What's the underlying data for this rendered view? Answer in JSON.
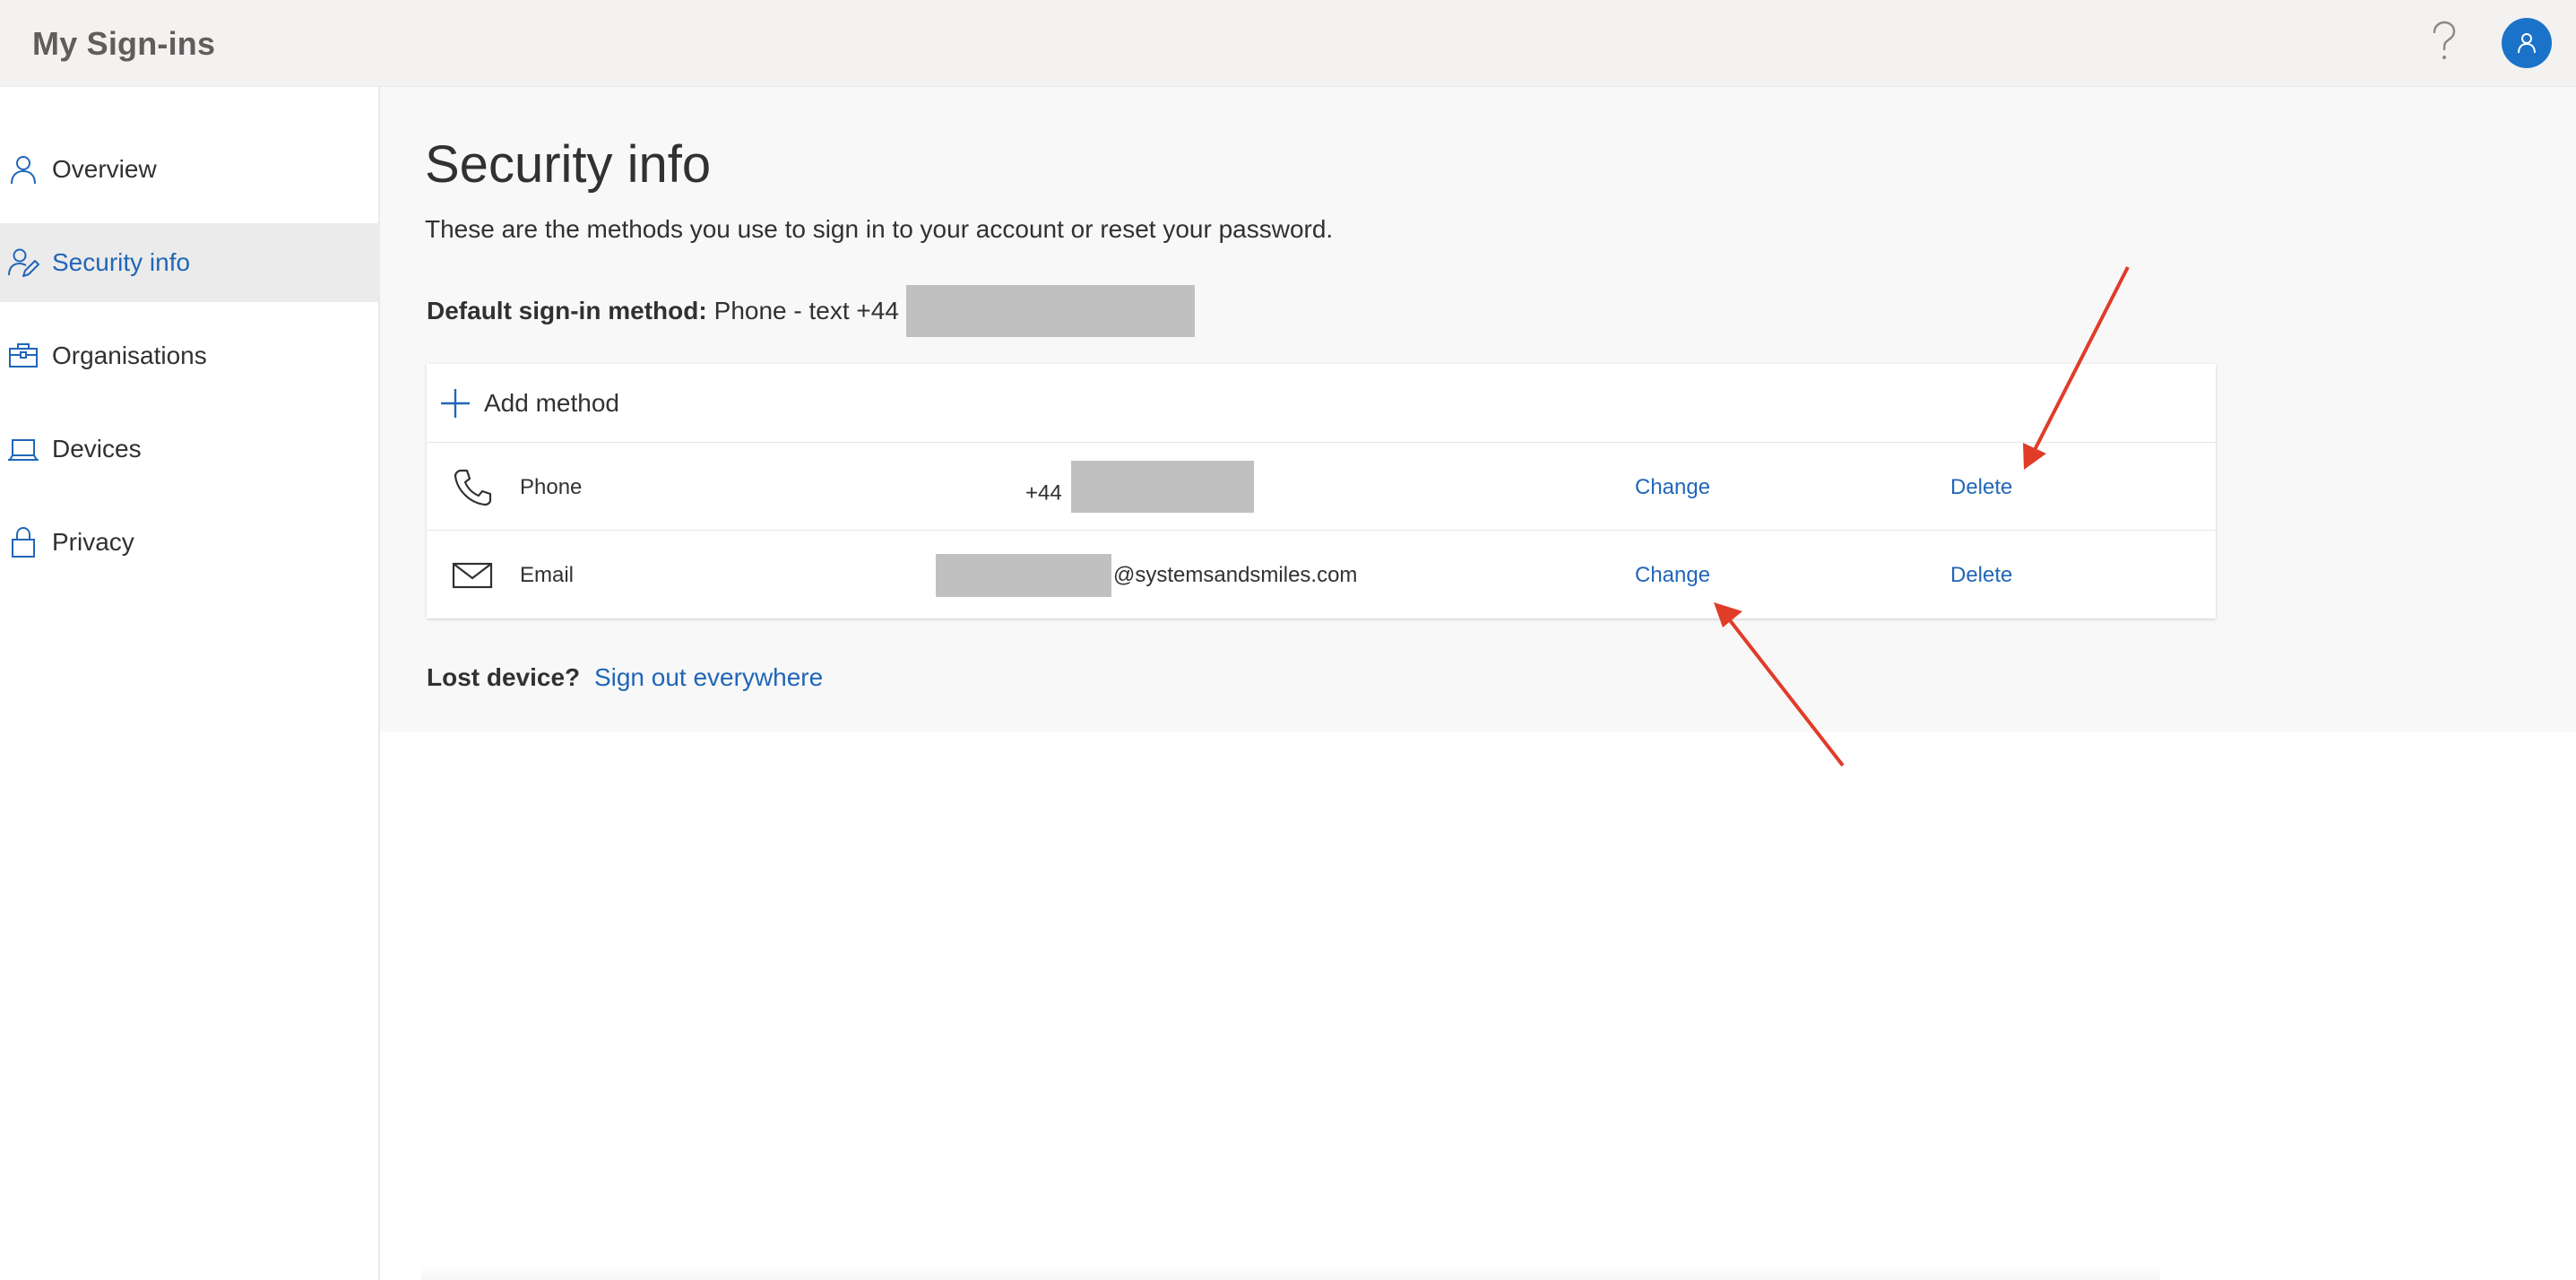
{
  "header": {
    "app_title": "My Sign-ins",
    "help_icon": "question-mark-icon",
    "avatar_icon": "person-icon",
    "accent_color": "#1a73c8"
  },
  "sidebar": {
    "items": [
      {
        "label": "Overview",
        "icon": "person-icon",
        "active": false
      },
      {
        "label": "Security info",
        "icon": "person-edit-icon",
        "active": true
      },
      {
        "label": "Organisations",
        "icon": "briefcase-icon",
        "active": false
      },
      {
        "label": "Devices",
        "icon": "laptop-icon",
        "active": false
      },
      {
        "label": "Privacy",
        "icon": "lock-icon",
        "active": false
      }
    ]
  },
  "main": {
    "title": "Security info",
    "description": "These are the methods you use to sign in to your account or reset your password.",
    "default_method": {
      "label": "Default sign-in method:",
      "value": "Phone - text +44"
    },
    "add_method_label": "Add method",
    "methods": [
      {
        "icon": "phone-icon",
        "name": "Phone",
        "value": "+44",
        "change_label": "Change",
        "delete_label": "Delete"
      },
      {
        "icon": "mail-icon",
        "name": "Email",
        "value": "@systemsandsmiles.com",
        "change_label": "Change",
        "delete_label": "Delete"
      }
    ],
    "lost_device": {
      "label": "Lost device?",
      "link": "Sign out everywhere"
    }
  },
  "colors": {
    "link": "#2166b8",
    "annotation_arrow": "#e03c28",
    "active_nav_bg": "#ebebeb"
  }
}
